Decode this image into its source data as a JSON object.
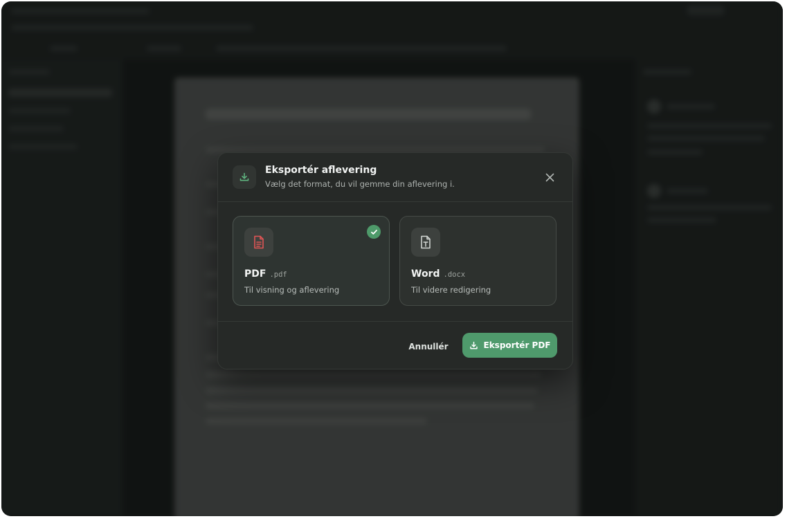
{
  "dialog": {
    "title": "Eksportér aflevering",
    "subtitle": "Vælg det format, du vil gemme din aflevering i.",
    "header_icon": "download-icon",
    "close_icon": "close-icon"
  },
  "options": [
    {
      "name": "PDF",
      "extension": ".pdf",
      "description": "Til visning og aflevering",
      "icon": "pdf-file-icon",
      "icon_color": "#e05555",
      "selected": true
    },
    {
      "name": "Word",
      "extension": ".docx",
      "description": "Til videre redigering",
      "icon": "text-file-icon",
      "icon_color": "#d5d9d6",
      "selected": false
    }
  ],
  "footer": {
    "cancel_label": "Annullér",
    "export_label": "Eksportér PDF",
    "export_icon": "download-icon"
  },
  "colors": {
    "accent": "#4f9a6c",
    "dialog_bg": "#262927",
    "pdf_red": "#e05555"
  }
}
